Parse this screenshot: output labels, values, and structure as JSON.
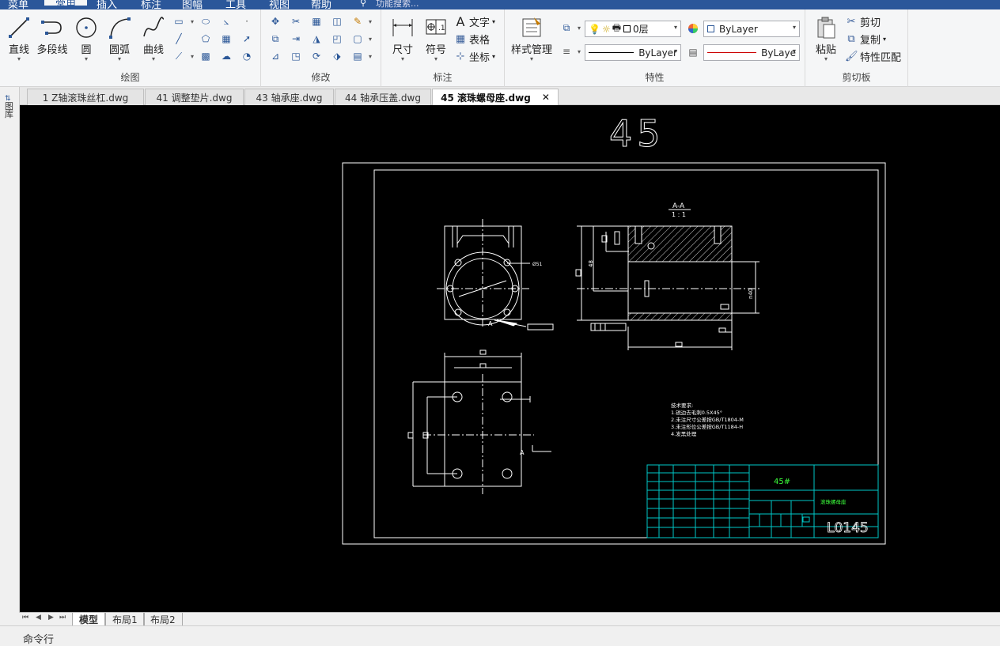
{
  "menu": {
    "items": [
      "菜单",
      "常用",
      "插入",
      "标注",
      "图幅",
      "工具",
      "视图",
      "帮助"
    ],
    "active": "常用",
    "search_placeholder": "功能搜索..."
  },
  "ribbon": {
    "draw": {
      "label": "绘图",
      "buttons": [
        "直线",
        "多段线",
        "圆",
        "圆弧",
        "曲线"
      ]
    },
    "modify": {
      "label": "修改"
    },
    "annotate": {
      "label": "标注",
      "dimension": "尺寸",
      "symbol": "符号",
      "text": "文字",
      "table": "表格",
      "coord": "坐标"
    },
    "properties": {
      "label": "特性",
      "style_manager": "样式管理",
      "layer_value": "0层",
      "color_value": "ByLayer",
      "linetype_value": "ByLayer",
      "lineweight_value": "ByLaye"
    },
    "clipboard": {
      "label": "剪切板",
      "paste": "粘贴",
      "cut": "剪切",
      "copy": "复制",
      "match": "特性匹配"
    }
  },
  "tabs": [
    {
      "label": "1 Z轴滚珠丝杠.dwg"
    },
    {
      "label": "41 调整垫片.dwg"
    },
    {
      "label": "43 轴承座.dwg"
    },
    {
      "label": "44 轴承压盖.dwg"
    },
    {
      "label": "45 滚珠螺母座.dwg",
      "active": true
    }
  ],
  "left_panel_label": "图库",
  "drawing": {
    "big_number": "45",
    "section_title": "A-A",
    "section_scale": "1 : 1",
    "dim_diameter": "Ø51",
    "section_mark": "A",
    "dim_left": "48",
    "dim_right": "n40",
    "tech_requirements": [
      "技术要求:",
      "1.锐边去毛刺0.5X45°",
      "2.未注尺寸公差按GB/T1804-M",
      "3.未注形位公差按GB/T1184-H",
      "4.发黑处理"
    ],
    "title_block": {
      "material": "45#",
      "part_name": "滚珠螺母座",
      "drawing_no": "L0145"
    },
    "colors": {
      "line": "#ffffff",
      "title_block": "#00c8c8",
      "material": "#3cff3c",
      "hatch": "#ffffff"
    }
  },
  "layouts": {
    "nav": [
      "⏮",
      "◀",
      "▶",
      "⏭"
    ],
    "tabs": [
      "模型",
      "布局1",
      "布局2"
    ],
    "active": "模型"
  },
  "command_line": "命令行"
}
